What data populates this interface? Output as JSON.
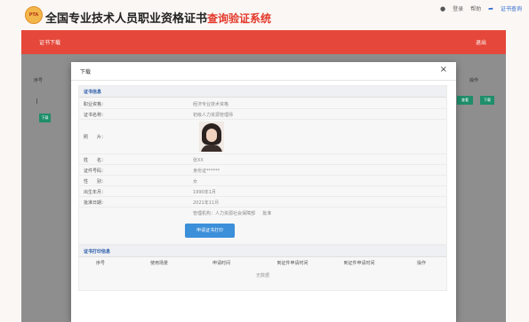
{
  "header": {
    "logo_text": "PTA",
    "title": "全国专业技术人员职业资格证书",
    "subtitle": "查询验证系统",
    "user_label": "登录",
    "help_label": "帮助",
    "verify_label": "证书查询"
  },
  "nav": {
    "tab_label": "证书下载",
    "logout_label": "退出"
  },
  "background": {
    "col_left": "序号",
    "col_right": "操作",
    "btn_left": "下载",
    "btn_view": "查看",
    "btn_download": "下载"
  },
  "modal": {
    "title": "下载",
    "close": "×",
    "cert_section": {
      "title": "证书信息",
      "rows": [
        {
          "label": "职业资格：",
          "value": "经济专业技术资格"
        },
        {
          "label": "证书名称：",
          "value": "初级人力资源管理师"
        },
        {
          "label": "照　　片：",
          "value": ""
        },
        {
          "label": "姓　　名：",
          "value": "张XX"
        },
        {
          "label": "证件号码：",
          "value": "身份证******"
        },
        {
          "label": "性　　别：",
          "value": "女"
        },
        {
          "label": "出生年月：",
          "value": "1990年1月"
        },
        {
          "label": "批准日期：",
          "value": "2021年11月"
        },
        {
          "label": "",
          "value": "管理机构：人力资源社会保障部 　 批准"
        }
      ],
      "print_button": "申请证书打印"
    },
    "print_section": {
      "title": "证书打印信息",
      "columns": [
        "序号",
        "使用场景",
        "申请时间",
        "到证件申请时间",
        "到证件申请时间",
        "操作"
      ],
      "empty_text": "无数据"
    }
  }
}
